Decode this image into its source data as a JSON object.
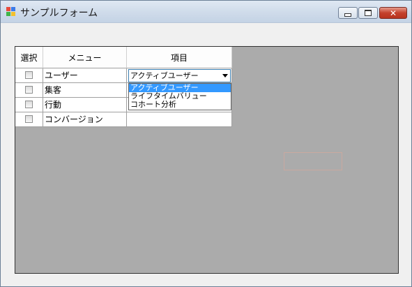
{
  "window": {
    "title": "サンプルフォーム",
    "controls": {
      "minimize": "",
      "maximize": "",
      "close": "✕"
    }
  },
  "grid": {
    "headers": [
      "選択",
      "メニュー",
      "項目"
    ],
    "rows": [
      {
        "checked": false,
        "menu": "ユーザー",
        "item": "アクティブユーザー"
      },
      {
        "checked": false,
        "menu": "集客",
        "item": ""
      },
      {
        "checked": false,
        "menu": "行動",
        "item": ""
      },
      {
        "checked": false,
        "menu": "コンバージョン",
        "item": ""
      }
    ],
    "combo": {
      "value": "アクティブユーザー",
      "options": [
        "アクティブユーザー",
        "ライフタイムバリュー",
        "コホート分析"
      ],
      "highlighted_index": 0
    }
  }
}
